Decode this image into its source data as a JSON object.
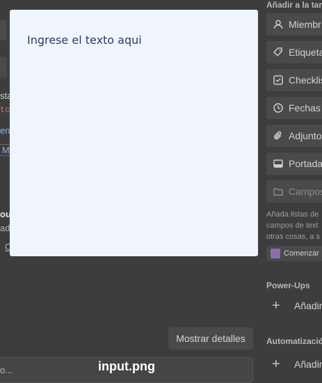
{
  "modal": {
    "input_text": "Ingrese el texto aqui"
  },
  "background": {
    "fragments": [
      "sta",
      "tc>",
      "eng",
      "M",
      "ou",
      "ad",
      "C"
    ],
    "show_details_label": "Mostrar detalles",
    "comment_placeholder": "o..."
  },
  "sidebar": {
    "add_heading": "Añadir a la tarj",
    "items": [
      {
        "label": "Miembr",
        "icon": "person-icon"
      },
      {
        "label": "Etiqueta",
        "icon": "tag-icon"
      },
      {
        "label": "Checklis",
        "icon": "checkbox-icon"
      },
      {
        "label": "Fechas",
        "icon": "clock-icon"
      },
      {
        "label": "Adjunto",
        "icon": "paperclip-icon"
      },
      {
        "label": "Portada",
        "icon": "cover-icon"
      },
      {
        "label": "Campos",
        "icon": "folder-icon"
      }
    ],
    "note_lines": [
      "Añada listas de",
      "campos de text",
      "otras cosas, a s"
    ],
    "start_label": "Comenzar",
    "powerups_heading": "Power-Ups",
    "powerups_add": "Añadir P",
    "automation_heading": "Automatizació",
    "automation_add": "Añadir I"
  },
  "caption": "input.png"
}
